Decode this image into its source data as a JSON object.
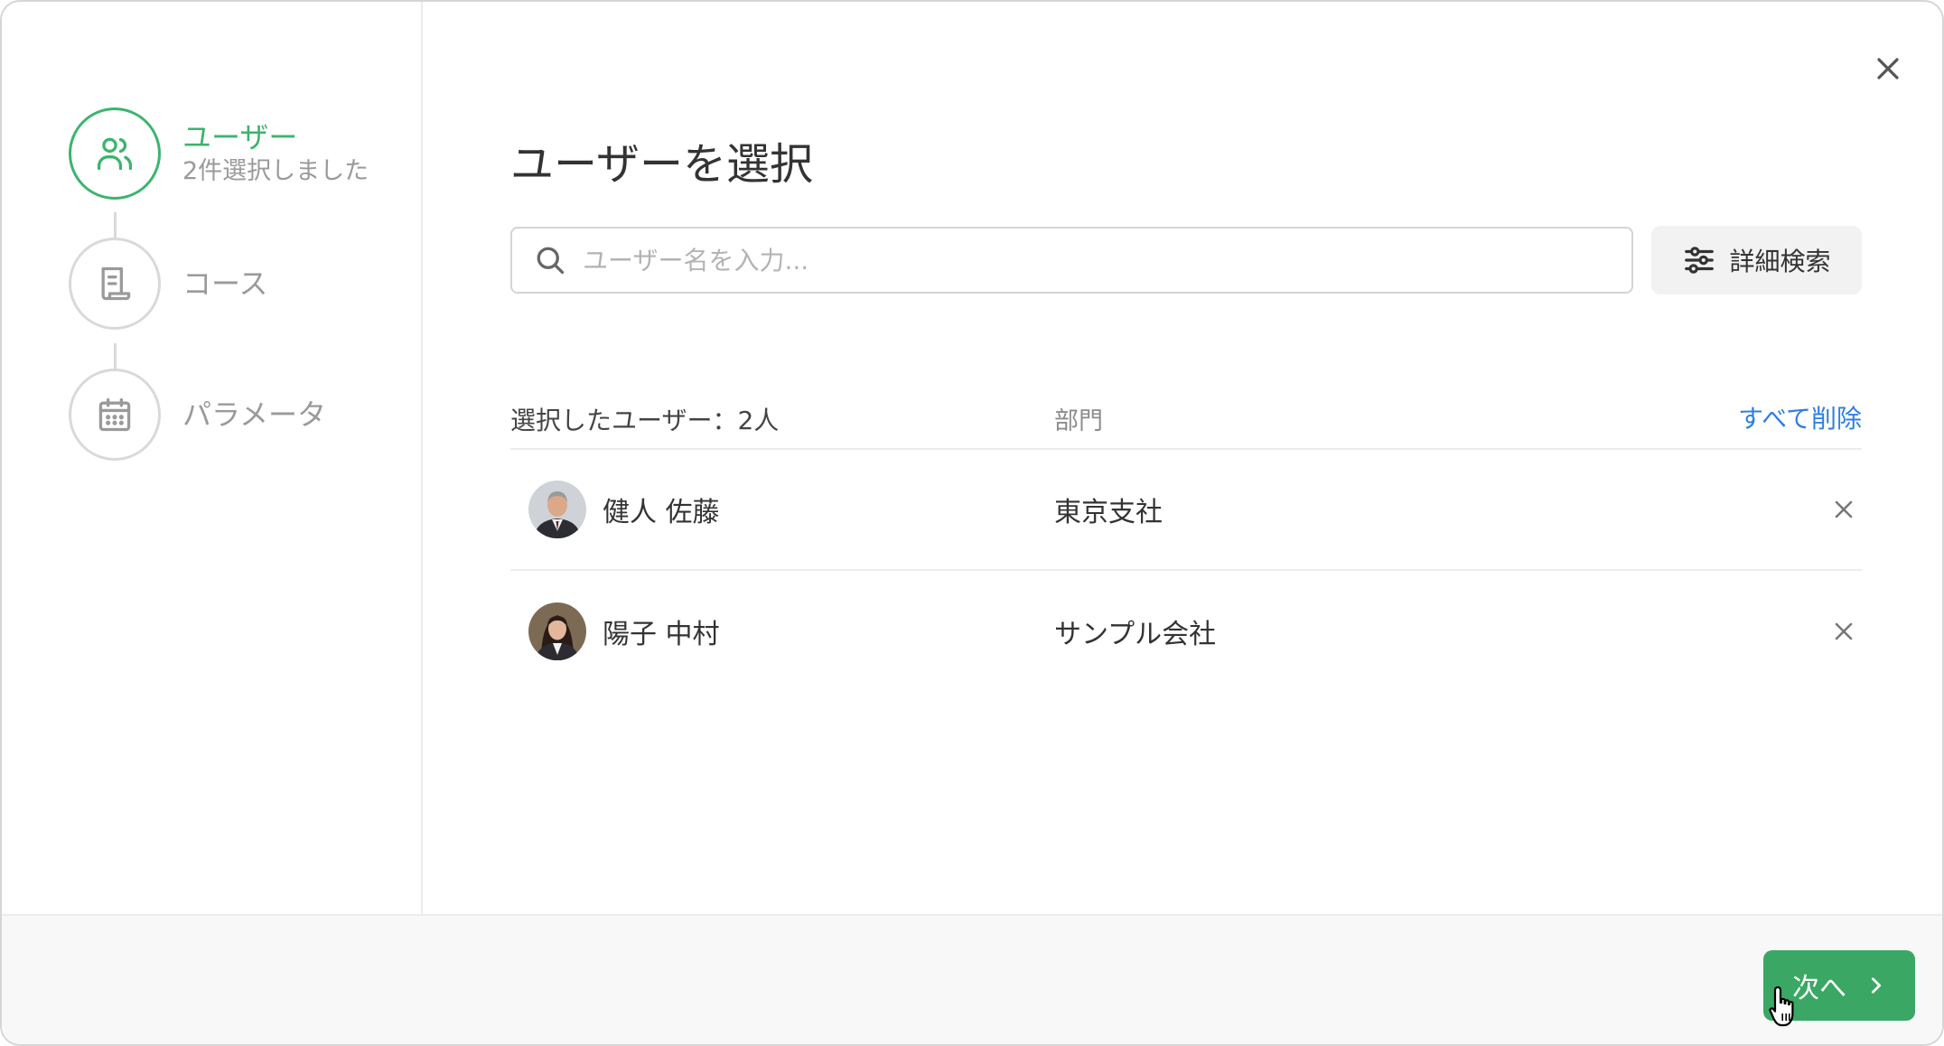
{
  "sidebar": {
    "steps": [
      {
        "label": "ユーザー",
        "sub": "2件選択しました",
        "icon": "users-icon",
        "active": true
      },
      {
        "label": "コース",
        "icon": "course-document-icon",
        "active": false
      },
      {
        "label": "パラメータ",
        "icon": "calendar-icon",
        "active": false
      }
    ]
  },
  "main": {
    "title": "ユーザーを選択",
    "search": {
      "placeholder": "ユーザー名を入力...",
      "value": ""
    },
    "advanced_search_label": "詳細検索",
    "list": {
      "count_label": "選択したユーザー：2人",
      "dept_header": "部門",
      "clear_all_label": "すべて削除",
      "users": [
        {
          "name": "健人 佐藤",
          "dept": "東京支社"
        },
        {
          "name": "陽子 中村",
          "dept": "サンプル会社"
        }
      ]
    }
  },
  "footer": {
    "next_label": "次へ"
  },
  "colors": {
    "accent_green": "#3cb46e",
    "button_green": "#3aa864",
    "link_blue": "#2f7fe0"
  }
}
